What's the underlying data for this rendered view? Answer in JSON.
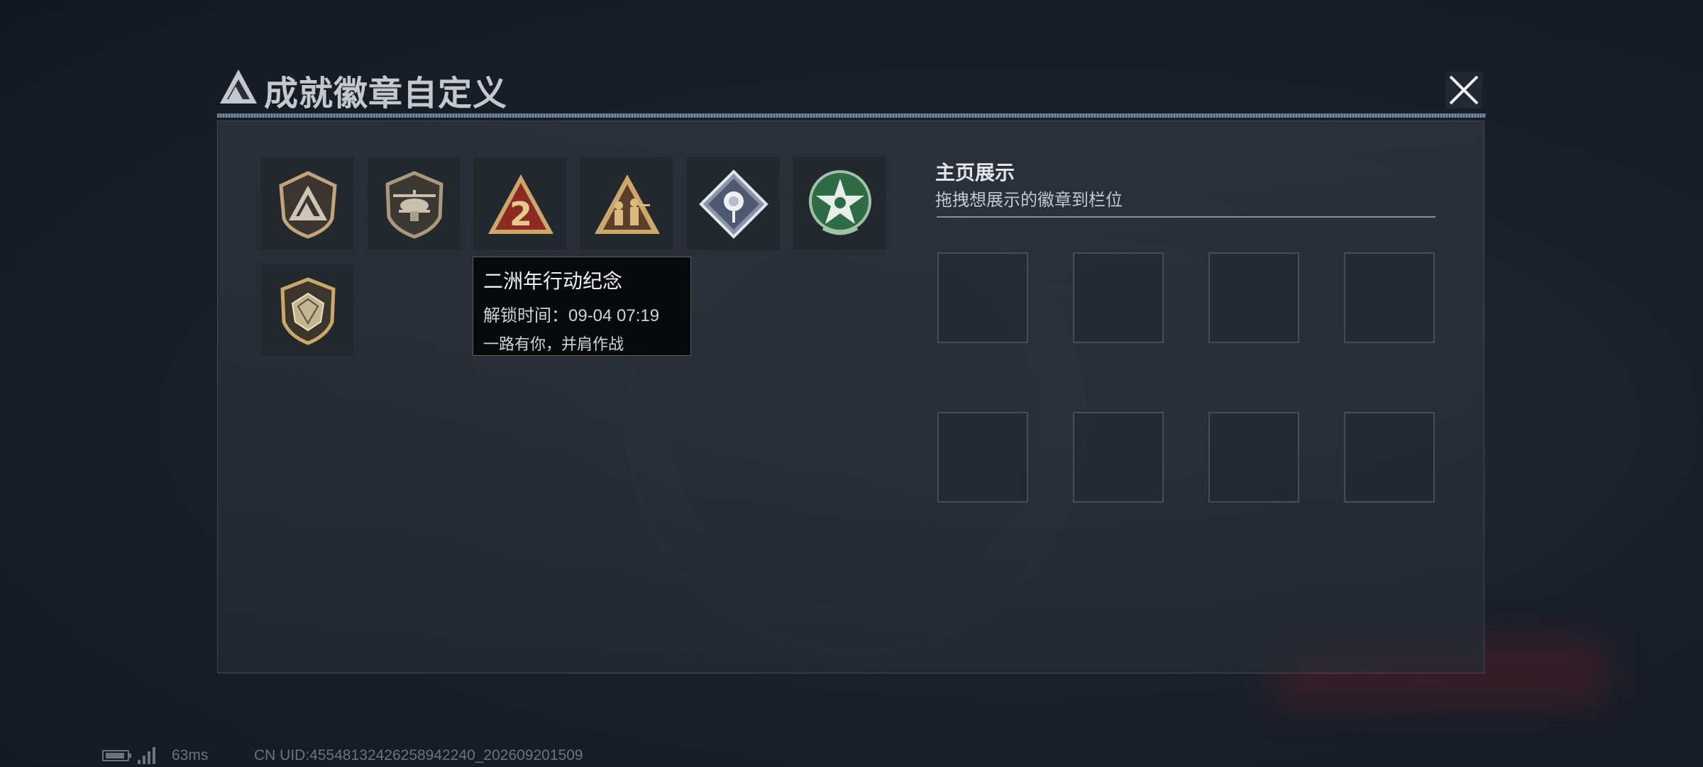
{
  "header": {
    "title": "成就徽章自定义",
    "close_icon": "close-icon",
    "logo_icon": "triangle-logo-icon"
  },
  "badges": [
    {
      "name": "shield-triangle-badge",
      "icon": "shield-badge-icon"
    },
    {
      "name": "helicopter-badge",
      "icon": "helicopter-badge-icon"
    },
    {
      "name": "anniversary-2-badge",
      "icon": "triangle-2-badge-icon"
    },
    {
      "name": "soldiers-triangle-badge",
      "icon": "soldiers-badge-icon"
    },
    {
      "name": "rose-diamond-badge",
      "icon": "rose-badge-icon"
    },
    {
      "name": "green-star-badge",
      "icon": "star-badge-icon"
    },
    {
      "name": "gem-shield-badge",
      "icon": "gem-badge-icon"
    }
  ],
  "tooltip": {
    "title": "二洲年行动纪念",
    "unlock_time": "解锁时间：09-04 07:19",
    "description": "一路有你，并肩作战"
  },
  "showcase": {
    "title": "主页展示",
    "subtitle": "拖拽想展示的徽章到栏位",
    "slot_count": 8
  },
  "footer": {
    "ping": "63ms",
    "uid": "CN UID:45548132426258942240_202609201509"
  },
  "colors": {
    "accent_gold": "#c9a86a",
    "accent_red": "#8e2a24",
    "accent_green": "#2f6b44",
    "background": "#1b2029"
  }
}
